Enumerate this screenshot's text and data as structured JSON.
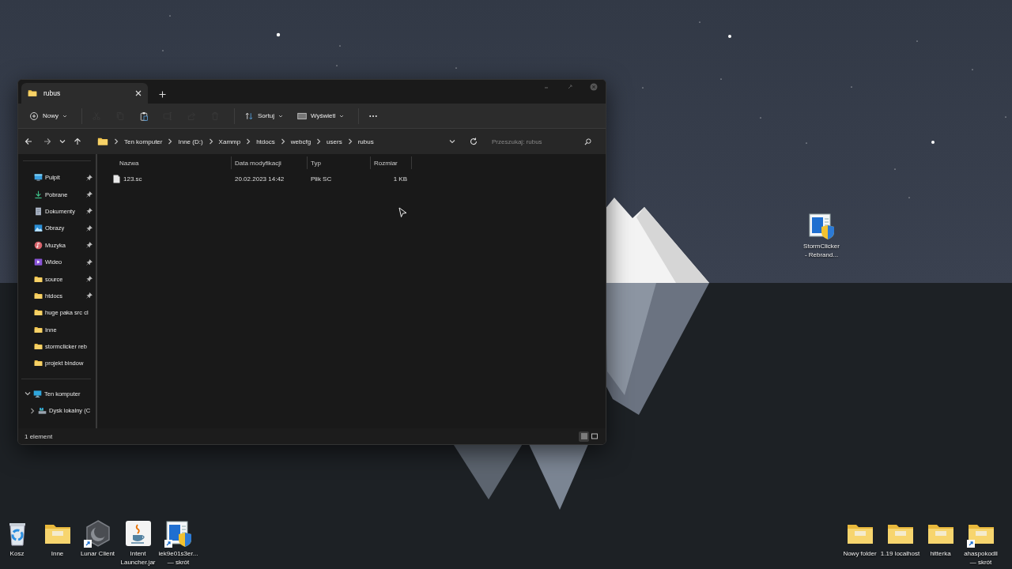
{
  "window": {
    "tab": {
      "title": "rubus",
      "selected": true
    },
    "window_controls": [
      {
        "kind": "minimize"
      },
      {
        "kind": "maximize"
      },
      {
        "kind": "close"
      }
    ],
    "toolbar": [
      {
        "kind": "new",
        "label": "Nowy",
        "disabled": false
      },
      {
        "kind": "cut",
        "disabled": true
      },
      {
        "kind": "copy",
        "disabled": true
      },
      {
        "kind": "paste",
        "disabled": false
      },
      {
        "kind": "rename",
        "disabled": true
      },
      {
        "kind": "share",
        "disabled": true
      },
      {
        "kind": "delete",
        "disabled": true
      },
      {
        "kind": "sort",
        "label": "Sortuj",
        "disabled": false
      },
      {
        "kind": "view",
        "label": "Wyświetl",
        "disabled": false
      },
      {
        "kind": "more",
        "disabled": false
      }
    ],
    "breadcrumb": [
      "Ten komputer",
      "Inne (D:)",
      "Xammp",
      "htdocs",
      "webcfg",
      "users",
      "rubus"
    ],
    "search": {
      "placeholder": "Przeszukaj: rubus"
    },
    "columns": [
      "Nazwa",
      "Data modyfikacji",
      "Typ",
      "Rozmiar"
    ],
    "rows": [
      {
        "name": "123.sc",
        "modified": "20.02.2023 14:42",
        "type": "Plik SC",
        "size": "1 KB",
        "selected": false
      }
    ],
    "quick_access": [
      {
        "label": "Pulpit",
        "kind": "desktop",
        "pinned": true
      },
      {
        "label": "Pobrane",
        "kind": "download",
        "pinned": true
      },
      {
        "label": "Dokumenty",
        "kind": "documents",
        "pinned": true
      },
      {
        "label": "Obrazy",
        "kind": "pictures",
        "pinned": true
      },
      {
        "label": "Muzyka",
        "kind": "music",
        "pinned": true
      },
      {
        "label": "Wideo",
        "kind": "video",
        "pinned": true
      },
      {
        "label": "source",
        "kind": "folder",
        "pinned": true
      },
      {
        "label": "htdocs",
        "kind": "folder",
        "pinned": true
      },
      {
        "label": "huge paka src cl",
        "kind": "folder",
        "pinned": false
      },
      {
        "label": "Inne",
        "kind": "folder",
        "pinned": false
      },
      {
        "label": "stormclicker reb",
        "kind": "folder",
        "pinned": false
      },
      {
        "label": "projekt bindow",
        "kind": "folder",
        "pinned": false
      }
    ],
    "tree": [
      {
        "label": "Ten komputer",
        "kind": "pc",
        "expanded": true,
        "children": [
          {
            "label": "Dysk lokalny (C",
            "kind": "drive",
            "expanded": false
          }
        ]
      }
    ],
    "status_bar": "1 element",
    "view_buttons": [
      {
        "kind": "details",
        "selected": true
      },
      {
        "kind": "tiles",
        "selected": false
      }
    ]
  },
  "desktop": {
    "top_right_icons": [
      {
        "label": "StormClicker\n- Rebrand...",
        "kind": "app",
        "shortcut": false
      }
    ],
    "bottom_left_icons": [
      {
        "label": "Kosz",
        "kind": "bin",
        "shortcut": false
      },
      {
        "label": "Inne",
        "kind": "folder",
        "shortcut": false
      },
      {
        "label": "Lunar Client",
        "kind": "lunar",
        "shortcut": true
      },
      {
        "label": "Intent\nLauncher.jar",
        "kind": "java",
        "shortcut": false
      },
      {
        "label": "iek9e01s3er...\n— skrót",
        "kind": "app",
        "shortcut": true
      }
    ],
    "bottom_right_icons": [
      {
        "label": "Nowy folder",
        "kind": "folder",
        "shortcut": false
      },
      {
        "label": "1.19 localhost",
        "kind": "folder",
        "shortcut": false
      },
      {
        "label": "hitterka",
        "kind": "folder",
        "shortcut": false
      },
      {
        "label": "ahaspokodll\n— skrót",
        "kind": "folder",
        "shortcut": true
      }
    ]
  }
}
